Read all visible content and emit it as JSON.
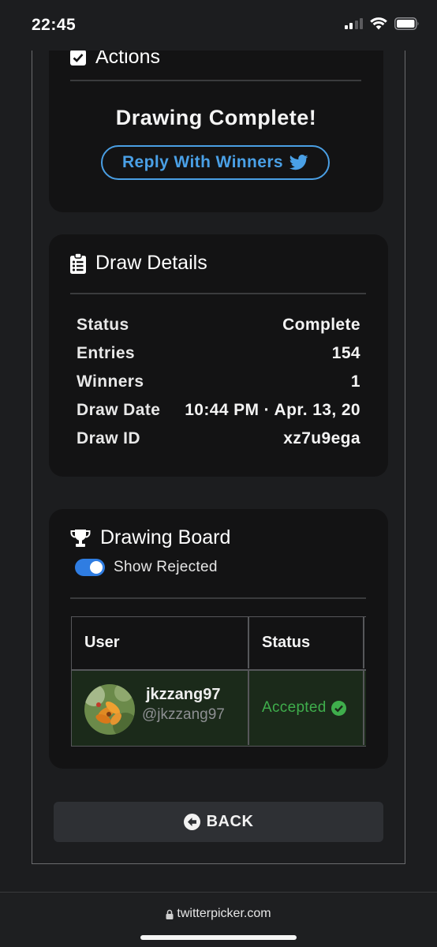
{
  "status_bar": {
    "time": "22:45"
  },
  "actions": {
    "title": "Actions",
    "complete_text": "Drawing Complete!",
    "reply_label": "Reply With Winners"
  },
  "details": {
    "title": "Draw Details",
    "rows": [
      {
        "key": "Status",
        "value": "Complete"
      },
      {
        "key": "Entries",
        "value": "154"
      },
      {
        "key": "Winners",
        "value": "1"
      },
      {
        "key": "Draw Date",
        "value": "10:44 PM · Apr. 13, 20"
      },
      {
        "key": "Draw ID",
        "value": "xz7u9ega"
      }
    ]
  },
  "board": {
    "title": "Drawing Board",
    "toggle_label": "Show Rejected",
    "toggle_on": true,
    "columns": [
      "User",
      "Status"
    ],
    "rows": [
      {
        "name": "jkzzang97",
        "handle": "@jkzzang97",
        "status": "Accepted"
      }
    ]
  },
  "back_label": "BACK",
  "browser": {
    "url": "twitterpicker.com"
  },
  "colors": {
    "accent_blue": "#4a9fe4",
    "accepted_green": "#3fae4c",
    "toggle_blue": "#2f7de2"
  }
}
